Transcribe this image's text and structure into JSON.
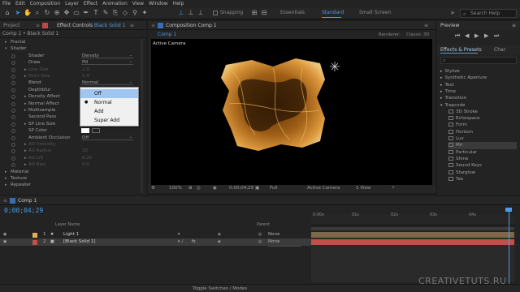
{
  "menu": [
    "File",
    "Edit",
    "Composition",
    "Layer",
    "Effect",
    "Animation",
    "View",
    "Window",
    "Help"
  ],
  "toolbar": {
    "snapping": "Snapping",
    "workspaces": [
      "Essentials",
      "Standard",
      "Small Screen"
    ],
    "active_workspace": "Standard",
    "search_placeholder": "Search Help"
  },
  "left_panel": {
    "tabs": {
      "project": "Project",
      "effect_controls": "Effect Controls",
      "layer": "Black Solid 1"
    },
    "subheader": "Comp 1 • Black Solid 1",
    "rows": [
      {
        "label": "Fractal",
        "indent": 0,
        "twirl": "▸",
        "value": "",
        "dim": false
      },
      {
        "label": "Shader",
        "indent": 0,
        "twirl": "▾",
        "value": "",
        "dim": false
      },
      {
        "label": "Shader",
        "indent": 1,
        "twirl": "",
        "value": "Density",
        "dim": false,
        "dropdown": true
      },
      {
        "label": "Draw",
        "indent": 1,
        "twirl": "",
        "value": "Fill",
        "dim": false,
        "dropdown": true
      },
      {
        "label": "Line Size",
        "indent": 1,
        "twirl": "▸",
        "value": "1.0",
        "dim": true
      },
      {
        "label": "Point Size",
        "indent": 1,
        "twirl": "▸",
        "value": "1.0",
        "dim": true
      },
      {
        "label": "Blend",
        "indent": 1,
        "twirl": "",
        "value": "Normal",
        "dim": false,
        "dropdown": true
      },
      {
        "label": "Depthblur",
        "indent": 1,
        "twirl": "",
        "value": "",
        "dim": false
      },
      {
        "label": "Density Affect",
        "indent": 1,
        "twirl": "▸",
        "value": "",
        "dim": false
      },
      {
        "label": "Normal Affect",
        "indent": 1,
        "twirl": "▸",
        "value": "",
        "dim": false
      },
      {
        "label": "Multisample",
        "indent": 1,
        "twirl": "▸",
        "value": "",
        "dim": false
      },
      {
        "label": "Second Pass",
        "indent": 1,
        "twirl": "",
        "value": "",
        "dim": false
      },
      {
        "label": "SP Line Size",
        "indent": 1,
        "twirl": "▸",
        "value": "",
        "dim": false
      },
      {
        "label": "SP Color",
        "indent": 1,
        "twirl": "",
        "value": "",
        "dim": false,
        "color": true
      },
      {
        "label": "Ambient Occlusion",
        "indent": 1,
        "twirl": "",
        "value": "Off",
        "dim": false,
        "dropdown": true
      },
      {
        "label": "AO Intensity",
        "indent": 1,
        "twirl": "▸",
        "value": "",
        "dim": true
      },
      {
        "label": "AO Radius",
        "indent": 1,
        "twirl": "▸",
        "value": "10",
        "dim": true
      },
      {
        "label": "AO Lift",
        "indent": 1,
        "twirl": "▸",
        "value": "0.20",
        "dim": true
      },
      {
        "label": "AO Bias",
        "indent": 1,
        "twirl": "▸",
        "value": "0.0",
        "dim": true
      },
      {
        "label": "Material",
        "indent": 0,
        "twirl": "▸",
        "value": "",
        "dim": false
      },
      {
        "label": "Texture",
        "indent": 0,
        "twirl": "▸",
        "value": "",
        "dim": false
      },
      {
        "label": "Repeater",
        "indent": 0,
        "twirl": "▸",
        "value": "",
        "dim": false
      }
    ]
  },
  "blend_popup": {
    "options": [
      "Off",
      "Normal",
      "Add",
      "Super Add"
    ],
    "highlighted": "Off",
    "checked": "Normal"
  },
  "viewer": {
    "tab": "Composition Comp 1",
    "subtab": "Comp 1",
    "renderer_label": "Renderer:",
    "renderer": "Classic 3D",
    "camera_label": "Active Camera",
    "bottom_bar": {
      "zoom": "100%",
      "timecode": "0;00;04;29",
      "resolution": "Full",
      "camera": "Active Camera",
      "views": "1 View"
    }
  },
  "right_panel": {
    "preview_tab": "Preview",
    "effects_tab": "Effects & Presets",
    "char_tab": "Char",
    "categories": [
      "Stylize",
      "Synthetic Aperture",
      "Text",
      "Time",
      "Transition",
      "Trapcode"
    ],
    "trapcode_items": [
      "3D Stroke",
      "Echospace",
      "Form",
      "Horizon",
      "Lux",
      "Mir",
      "Particular",
      "Shine",
      "Sound Keys",
      "Starglow",
      "Tao"
    ],
    "selected": "Mir"
  },
  "timeline": {
    "tab": "Comp 1",
    "timecode": "0;00;04;29",
    "col_layer_name": "Layer Name",
    "col_parent": "Parent",
    "layers": [
      {
        "index": "1",
        "name": "Light 1",
        "parent": "None",
        "label_color": "#e0b060"
      },
      {
        "index": "2",
        "name": "[Black Solid 1]",
        "parent": "None",
        "label_color": "#c0504a"
      }
    ],
    "ruler_ticks": [
      "0:00s",
      "01s",
      "02s",
      "03s",
      "04s"
    ],
    "footer": "Toggle Switches / Modes"
  },
  "watermark": "CREATIVETUTS.RU",
  "colors": {
    "accent": "#4a9de6",
    "solid_bar": "#c0504a",
    "light_bar": "#7a6a4a"
  }
}
